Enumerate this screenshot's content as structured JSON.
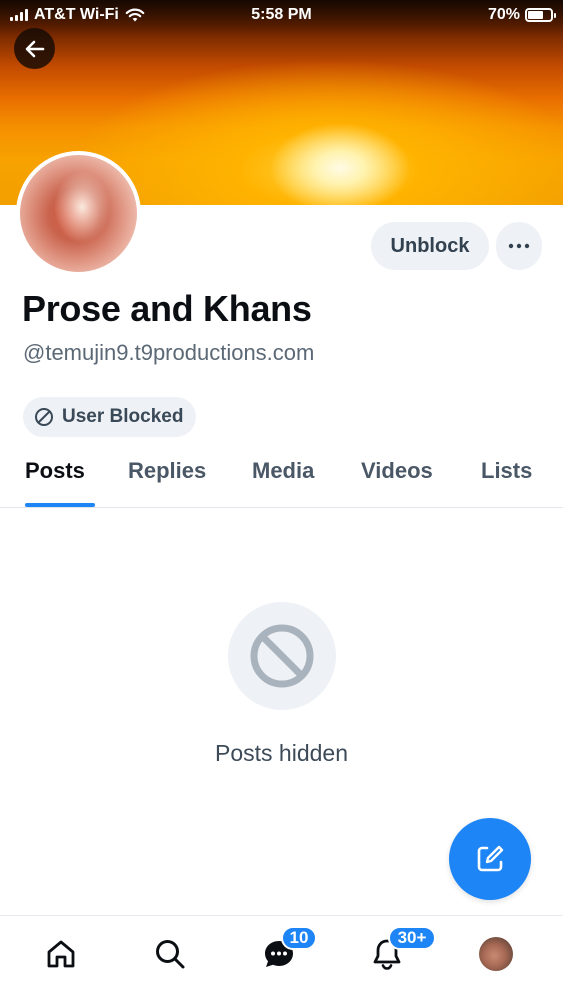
{
  "status_bar": {
    "carrier": "AT&T Wi-Fi",
    "time": "5:58 PM",
    "battery_percent": "70%",
    "battery_level": 0.7
  },
  "header": {
    "back_icon": "arrow-left-icon"
  },
  "profile": {
    "display_name": "Prose and Khans",
    "handle": "@temujin9.t9productions.com",
    "unblock_label": "Unblock",
    "more_icon": "ellipsis-icon",
    "blocked_label": "User Blocked",
    "blocked_icon": "circle-slash-icon"
  },
  "tabs": [
    {
      "label": "Posts",
      "active": true
    },
    {
      "label": "Replies",
      "active": false
    },
    {
      "label": "Media",
      "active": false
    },
    {
      "label": "Videos",
      "active": false
    },
    {
      "label": "Lists",
      "active": false
    }
  ],
  "empty_state": {
    "icon": "circle-slash-icon",
    "message": "Posts hidden"
  },
  "fab": {
    "icon": "compose-icon"
  },
  "bottom_nav": {
    "home_icon": "home-icon",
    "search_icon": "search-icon",
    "messages_icon": "chat-bubble-icon",
    "messages_badge": "10",
    "notifications_icon": "bell-icon",
    "notifications_badge": "30+",
    "profile_icon": "avatar"
  },
  "colors": {
    "accent": "#1d85f5",
    "pill_background": "#eef1f5",
    "muted_text": "#5b6875"
  }
}
